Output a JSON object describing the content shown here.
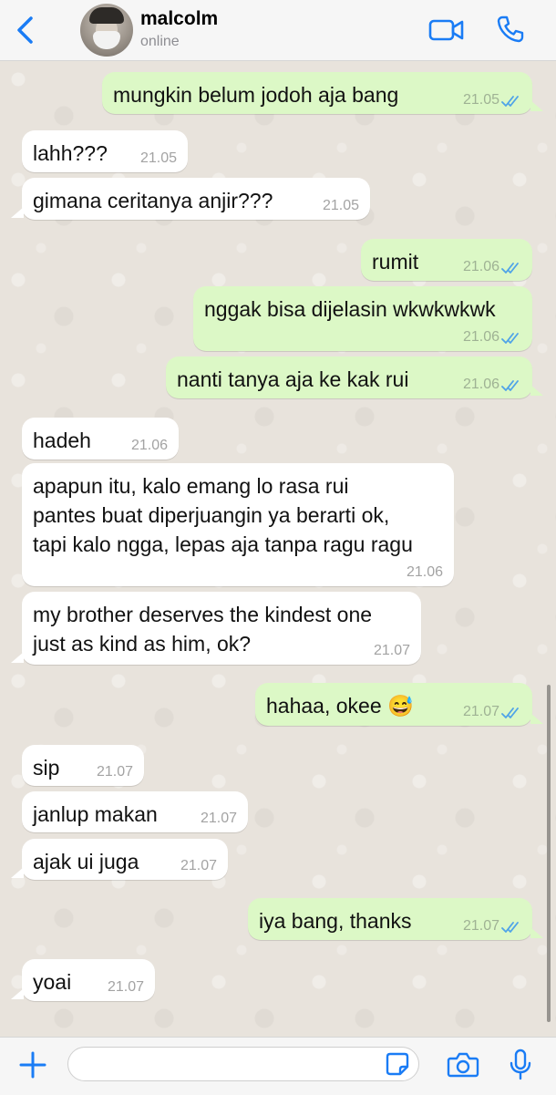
{
  "header": {
    "contact_name": "malcolm",
    "status": "online",
    "accent_color": "#1a7cf5"
  },
  "messages": [
    {
      "dir": "out",
      "text": "mungkin belum jodoh aja bang",
      "time": "21.05",
      "read": true
    },
    {
      "dir": "in",
      "text": "lahh???",
      "time": "21.05"
    },
    {
      "dir": "in",
      "text": "gimana ceritanya anjir???",
      "time": "21.05"
    },
    {
      "dir": "out",
      "text": "rumit",
      "time": "21.06",
      "read": true
    },
    {
      "dir": "out",
      "text": "nggak bisa dijelasin wkwkwkwk",
      "time": "21.06",
      "read": true
    },
    {
      "dir": "out",
      "text": "nanti tanya aja ke kak rui",
      "time": "21.06",
      "read": true
    },
    {
      "dir": "in",
      "text": "hadeh",
      "time": "21.06"
    },
    {
      "dir": "in",
      "text": "apapun itu, kalo emang lo rasa rui\npantes buat diperjuangin ya berarti ok,\ntapi kalo ngga, lepas aja tanpa ragu ragu",
      "time": "21.06"
    },
    {
      "dir": "in",
      "text": "my brother deserves the kindest one\njust as kind as him, ok?",
      "time": "21.07"
    },
    {
      "dir": "out",
      "text": "hahaa, okee 😅",
      "time": "21.07",
      "read": true
    },
    {
      "dir": "in",
      "text": "sip",
      "time": "21.07"
    },
    {
      "dir": "in",
      "text": "janlup makan",
      "time": "21.07"
    },
    {
      "dir": "in",
      "text": "ajak ui juga",
      "time": "21.07"
    },
    {
      "dir": "out",
      "text": "iya bang, thanks",
      "time": "21.07",
      "read": true
    },
    {
      "dir": "in",
      "text": "yoai",
      "time": "21.07"
    }
  ],
  "composer": {
    "placeholder": ""
  },
  "icons": {
    "back": "chevron-left-icon",
    "video": "video-camera-icon",
    "phone": "phone-icon",
    "plus": "plus-icon",
    "sticker": "sticker-icon",
    "camera": "camera-icon",
    "mic": "microphone-icon"
  },
  "colors": {
    "outgoing_bubble": "#dcf8c6",
    "incoming_bubble": "#ffffff",
    "read_ticks": "#4fa3e8"
  }
}
